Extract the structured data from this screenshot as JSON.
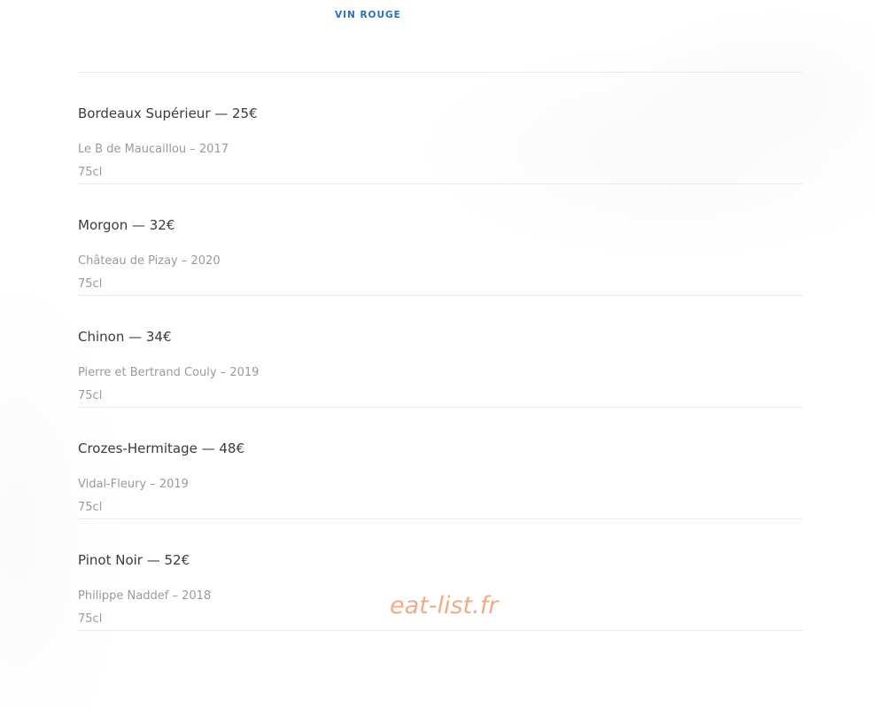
{
  "section_tab": "VIN ROUGE",
  "wines": [
    {
      "title": "Bordeaux Supérieur — 25€",
      "producer": "Le B de Maucaillou – 2017",
      "volume": "75cl"
    },
    {
      "title": "Morgon — 32€",
      "producer": "Château de Pizay – 2020",
      "volume": "75cl"
    },
    {
      "title": "Chinon — 34€",
      "producer": "Pierre et Bertrand Couly – 2019",
      "volume": "75cl"
    },
    {
      "title": "Crozes-Hermitage — 48€",
      "producer": "Vidal-Fleury – 2019",
      "volume": "75cl"
    },
    {
      "title": "Pinot Noir — 52€",
      "producer": "Philippe Naddef – 2018",
      "volume": "75cl"
    }
  ],
  "watermark": "eat-list.fr",
  "colors": {
    "accent": "#2a6fbd",
    "watermark": "#f0a47a",
    "divider": "#e9e9e9"
  }
}
